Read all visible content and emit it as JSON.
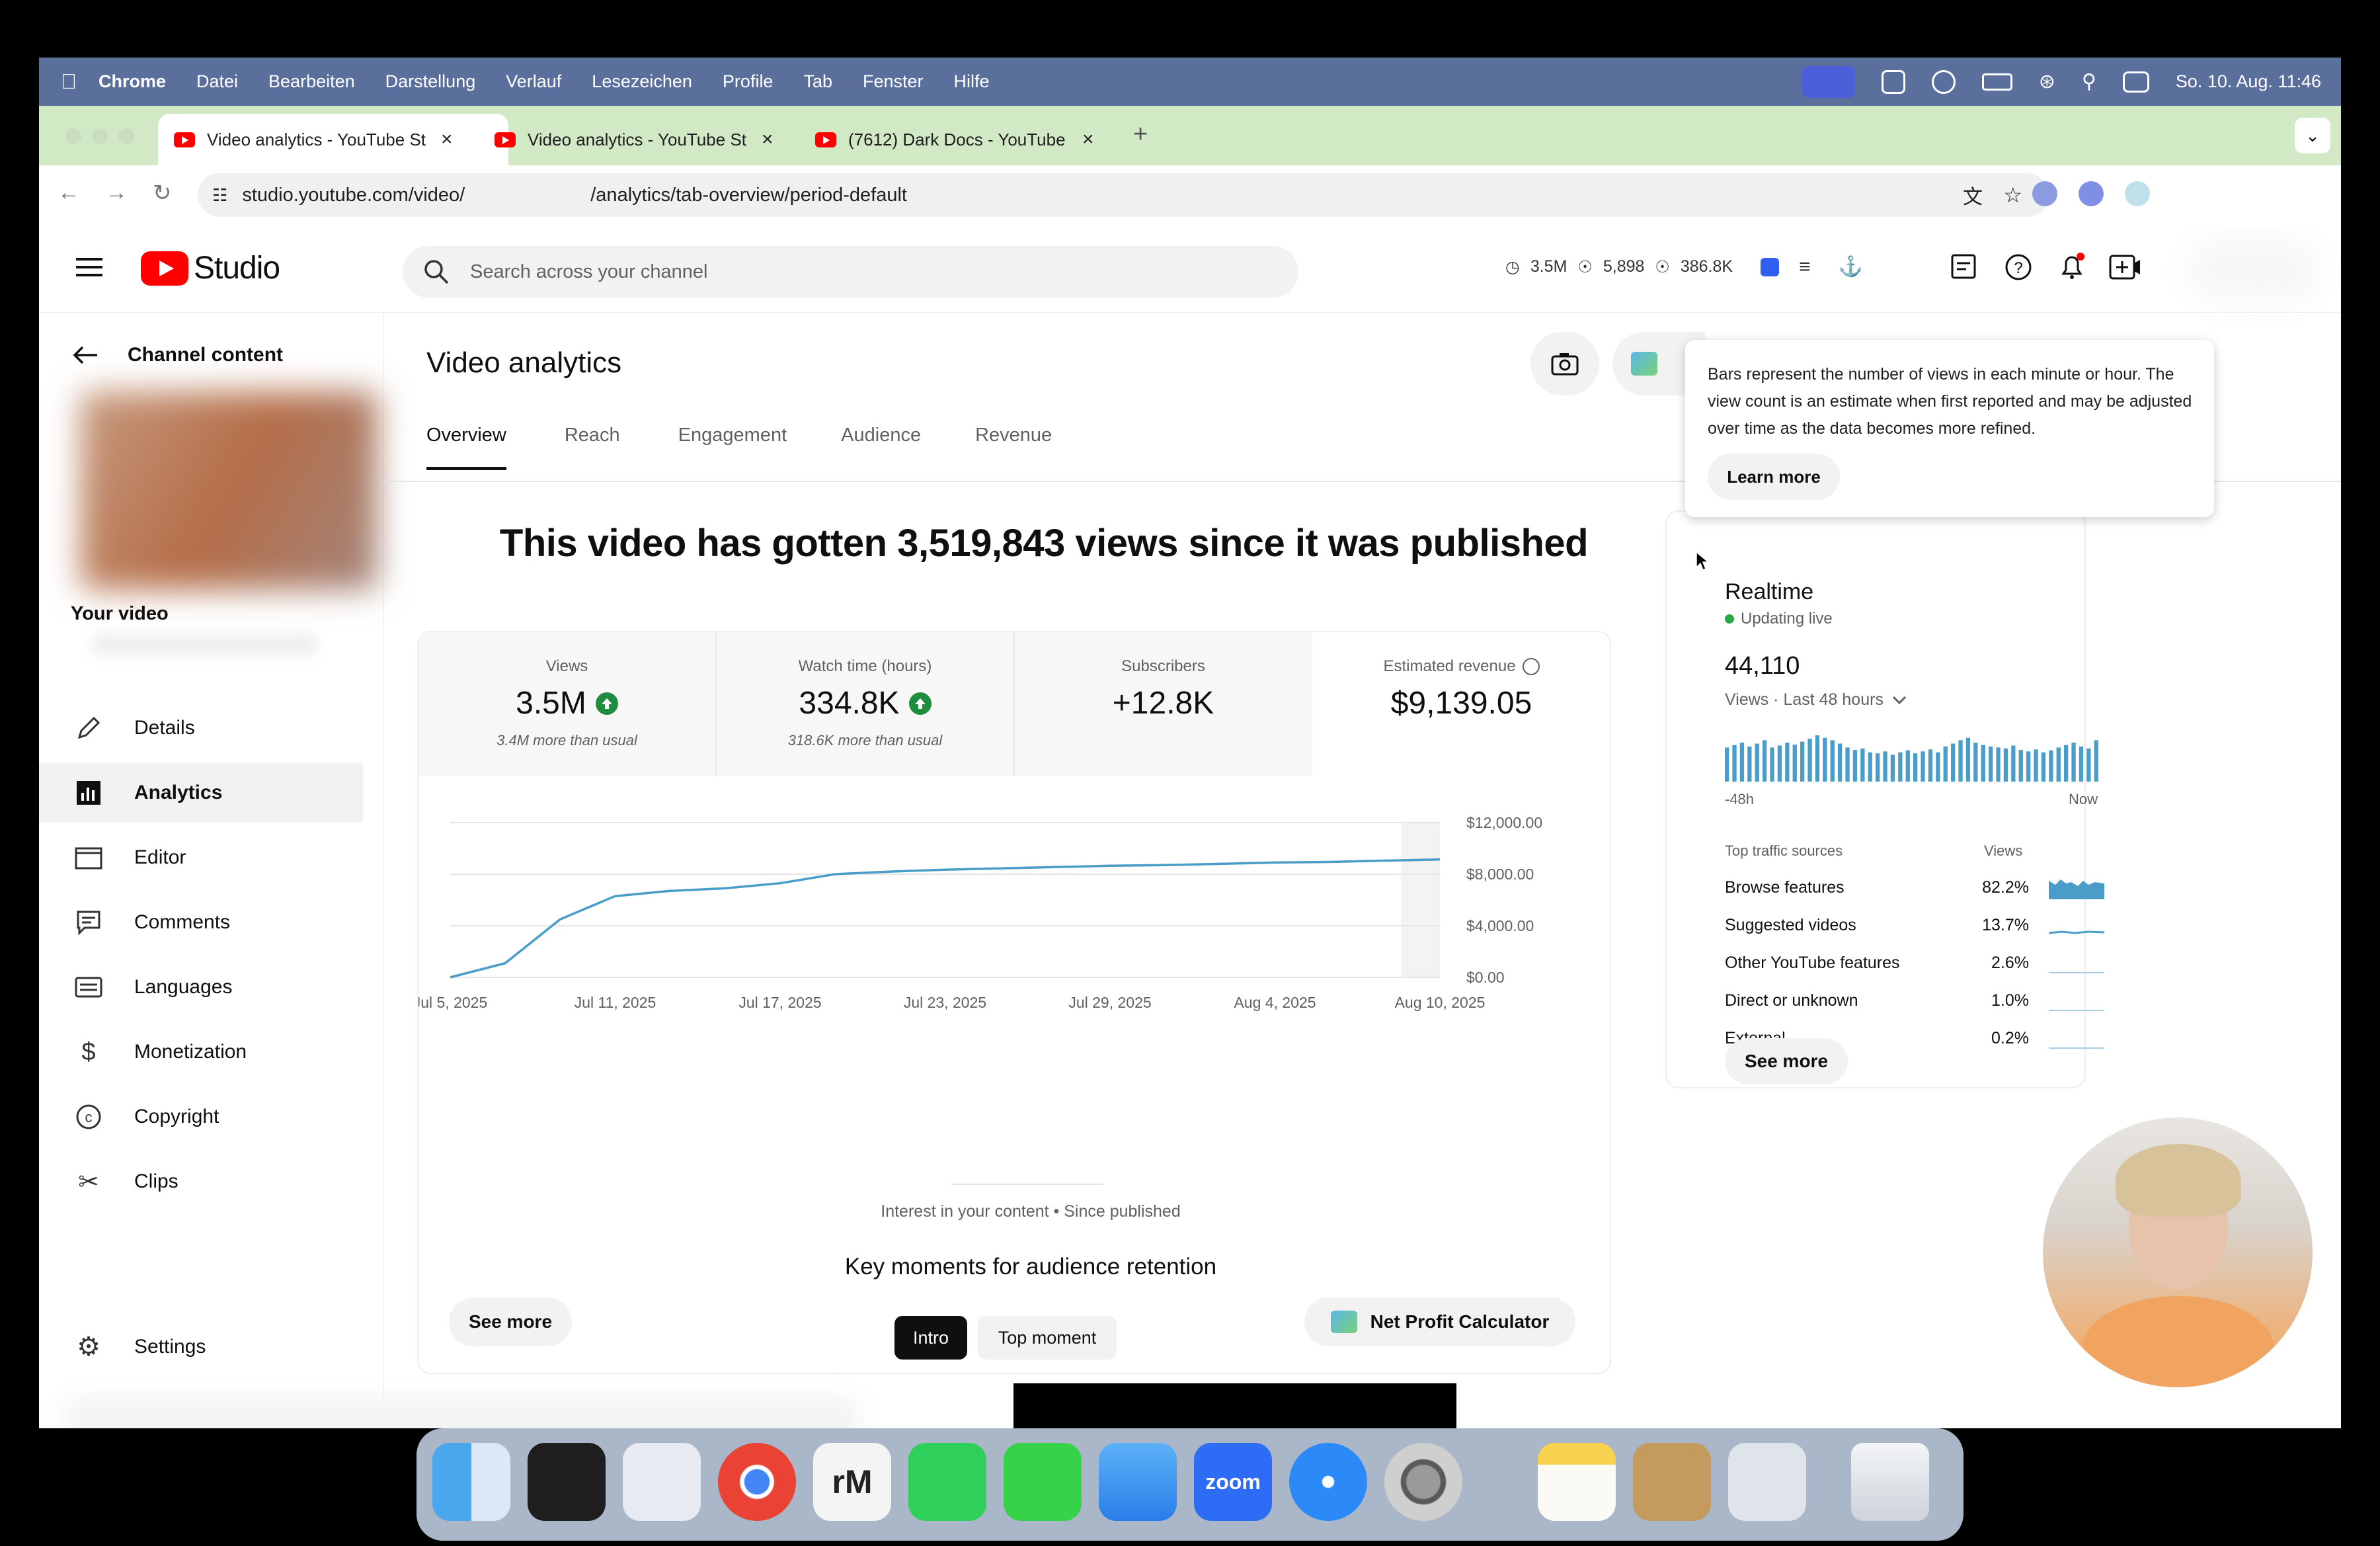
{
  "menubar": {
    "app": "Chrome",
    "items": [
      "Datei",
      "Bearbeiten",
      "Darstellung",
      "Verlauf",
      "Lesezeichen",
      "Profile",
      "Tab",
      "Fenster",
      "Hilfe"
    ],
    "clock": "So. 10. Aug. 11:46"
  },
  "tabs": [
    {
      "title": "Video analytics - YouTube St",
      "active": true
    },
    {
      "title": "Video analytics - YouTube St",
      "active": false
    },
    {
      "title": "(7612) Dark Docs - YouTube",
      "active": false
    }
  ],
  "address": {
    "url_part1": "studio.youtube.com/video/",
    "url_part2": "/analytics/tab-overview/period-default"
  },
  "header": {
    "logo_text": "Studio",
    "search_placeholder": "Search across your channel",
    "stats": [
      "3.5M",
      "5,898",
      "386.8K"
    ]
  },
  "sidebar": {
    "back_label": "Channel content",
    "your_video": "Your video",
    "items": [
      {
        "label": "Details",
        "icon": "pencil-icon"
      },
      {
        "label": "Analytics",
        "icon": "analytics-icon"
      },
      {
        "label": "Editor",
        "icon": "editor-icon"
      },
      {
        "label": "Comments",
        "icon": "comments-icon"
      },
      {
        "label": "Languages",
        "icon": "languages-icon"
      },
      {
        "label": "Monetization",
        "icon": "dollar-icon"
      },
      {
        "label": "Copyright",
        "icon": "copyright-icon"
      },
      {
        "label": "Clips",
        "icon": "scissors-icon"
      }
    ],
    "settings": "Settings"
  },
  "main": {
    "title": "Video analytics",
    "tabs": [
      "Overview",
      "Reach",
      "Engagement",
      "Audience",
      "Revenue"
    ],
    "headline": "This video has gotten 3,519,843 views since it was published",
    "metrics": [
      {
        "label": "Views",
        "value": "3.5M",
        "sub": "3.4M more than usual"
      },
      {
        "label": "Watch time (hours)",
        "value": "334.8K",
        "sub": "318.6K more than usual"
      },
      {
        "label": "Subscribers",
        "value": "+12.8K",
        "sub": ""
      },
      {
        "label": "Estimated revenue",
        "value": "$9,139.05",
        "sub": ""
      }
    ],
    "see_more": "See more",
    "net_profit": "Net Profit Calculator",
    "interest": "Interest in your content • Since published",
    "key_moments": "Key moments for audience retention",
    "moment_tabs": [
      "Intro",
      "Top moment"
    ]
  },
  "chart_data": {
    "type": "line",
    "x": [
      "Jul 5, 2025",
      "Jul 7, 2025",
      "Jul 9, 2025",
      "Jul 11, 2025",
      "Jul 13, 2025",
      "Jul 15, 2025",
      "Jul 17, 2025",
      "Jul 19, 2025",
      "Jul 21, 2025",
      "Jul 23, 2025",
      "Jul 25, 2025",
      "Jul 27, 2025",
      "Jul 29, 2025",
      "Jul 31, 2025",
      "Aug 2, 2025",
      "Aug 4, 2025",
      "Aug 6, 2025",
      "Aug 8, 2025",
      "Aug 10, 2025"
    ],
    "values": [
      0,
      1100,
      4500,
      6300,
      6700,
      6900,
      7300,
      8000,
      8200,
      8350,
      8450,
      8550,
      8650,
      8700,
      8800,
      8900,
      8950,
      9050,
      9139.05
    ],
    "x_ticks": [
      "Jul 5, 2025",
      "Jul 11, 2025",
      "Jul 17, 2025",
      "Jul 23, 2025",
      "Jul 29, 2025",
      "Aug 4, 2025",
      "Aug 10, 2025"
    ],
    "y_ticks": [
      "$0.00",
      "$4,000.00",
      "$8,000.00",
      "$12,000.00"
    ],
    "ylim": [
      0,
      12000
    ],
    "grid": true,
    "color": "#4a9cc9"
  },
  "realtime": {
    "title": "Realtime",
    "status": "Updating live",
    "count": "44,110",
    "period": "Views · Last 48 hours",
    "bars": [
      70,
      75,
      80,
      72,
      78,
      85,
      70,
      74,
      80,
      76,
      82,
      88,
      95,
      90,
      85,
      78,
      70,
      65,
      68,
      60,
      58,
      62,
      55,
      60,
      64,
      58,
      62,
      66,
      60,
      72,
      78,
      85,
      90,
      80,
      75,
      72,
      70,
      68,
      74,
      65,
      62,
      66,
      60,
      64,
      70,
      75,
      80,
      72,
      68,
      85
    ],
    "x_start": "-48h",
    "x_end": "Now",
    "ts_header": "Top traffic sources",
    "ts_views": "Views",
    "sources": [
      {
        "name": "Browse features",
        "pct": "82.2%"
      },
      {
        "name": "Suggested videos",
        "pct": "13.7%"
      },
      {
        "name": "Other YouTube features",
        "pct": "2.6%"
      },
      {
        "name": "Direct or unknown",
        "pct": "1.0%"
      },
      {
        "name": "External",
        "pct": "0.2%"
      }
    ],
    "see_more": "See more"
  },
  "tooltip": {
    "text": "Bars represent the number of views in each minute or hour. The view count is an estimate when first reported and may be adjusted over time as the data becomes more refined.",
    "learn_more": "Learn more"
  },
  "colors": {
    "accent_line": "#4a9cc9",
    "menubar": "#5a6f9c",
    "tabbar": "#d2e9c6",
    "positive": "#1e8e3e",
    "youtube_red": "#ff0000"
  }
}
